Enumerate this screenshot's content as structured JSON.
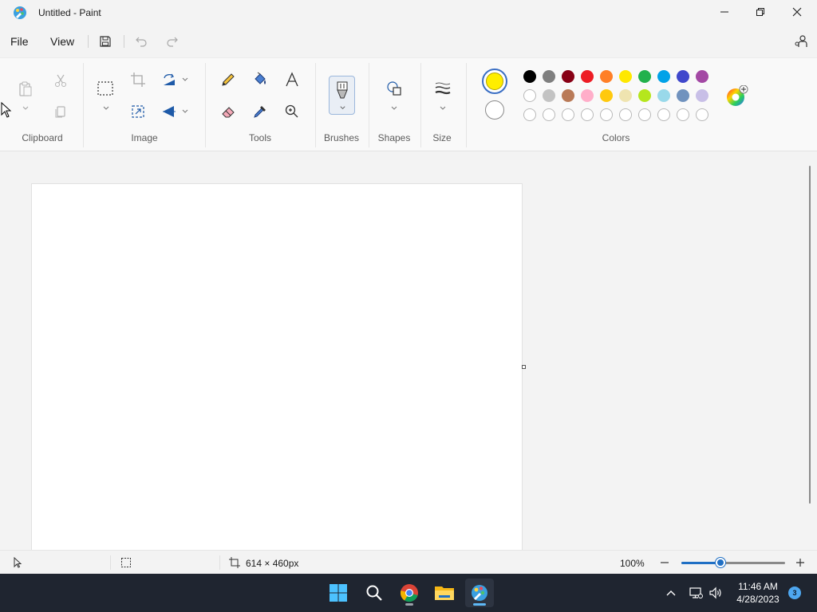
{
  "window": {
    "title": "Untitled - Paint"
  },
  "menu": {
    "file": "File",
    "view": "View"
  },
  "ribbon": {
    "groups": {
      "clipboard": "Clipboard",
      "image": "Image",
      "tools": "Tools",
      "brushes": "Brushes",
      "shapes": "Shapes",
      "size": "Size",
      "colors": "Colors"
    }
  },
  "colors": {
    "primary": "#ffee00",
    "secondary": "#ffffff",
    "palette_row1": [
      "#000000",
      "#7f7f7f",
      "#880015",
      "#ed1c24",
      "#ff7f27",
      "#ffe800",
      "#22b14c",
      "#00a2e8",
      "#3f48cc",
      "#a349a4"
    ],
    "palette_row2": [
      "#ffffff",
      "#c3c3c3",
      "#b97a57",
      "#ffaec9",
      "#ffc90e",
      "#efe4b0",
      "#b5e61d",
      "#99d9ea",
      "#7092be",
      "#c8bfe7"
    ],
    "custom_count": 10
  },
  "status": {
    "canvas_size": "614 × 460px",
    "zoom": "100%",
    "zoom_fraction": 0.38
  },
  "taskbar": {
    "time": "11:46 AM",
    "date": "4/28/2023",
    "notifications": "3"
  }
}
